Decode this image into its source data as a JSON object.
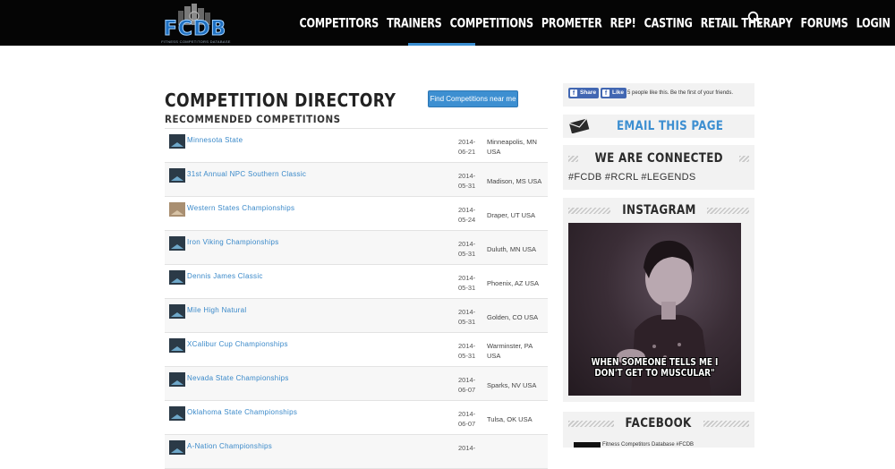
{
  "header": {
    "logo_text": "FCDB",
    "logo_subtitle": "FITNESS COMPETITORS DATABASE",
    "nav": [
      {
        "label": "COMPETITORS"
      },
      {
        "label": "TRAINERS"
      },
      {
        "label": "COMPETITIONS"
      },
      {
        "label": "PROMETER"
      },
      {
        "label": "REP!"
      },
      {
        "label": "CASTING"
      },
      {
        "label": "RETAIL THERAPY"
      },
      {
        "label": "FORUMS"
      },
      {
        "label": "LOGIN"
      }
    ],
    "search_icon": "search-icon",
    "active_color": "#3a8ed1"
  },
  "main": {
    "title": "COMPETITION DIRECTORY",
    "subtitle": "RECOMMENDED COMPETITIONS",
    "find_button": "Find Competitions near me",
    "competitions": [
      {
        "name": "Minnesota State",
        "date_y": "2014-",
        "date_md": "06-21",
        "location": "Minneapolis, MN USA"
      },
      {
        "name": "31st Annual NPC Southern Classic",
        "date_y": "2014-",
        "date_md": "05-31",
        "location": "Madison, MS USA"
      },
      {
        "name": "Western States Championships",
        "date_y": "2014-",
        "date_md": "05-24",
        "location": "Draper, UT USA"
      },
      {
        "name": "Iron Viking Championships",
        "date_y": "2014-",
        "date_md": "05-31",
        "location": "Duluth, MN USA"
      },
      {
        "name": "Dennis James Classic",
        "date_y": "2014-",
        "date_md": "05-31",
        "location": "Phoenix, AZ USA"
      },
      {
        "name": "Mile High Natural",
        "date_y": "2014-",
        "date_md": "05-31",
        "location": "Golden, CO USA"
      },
      {
        "name": "XCalibur Cup Championships",
        "date_y": "2014-",
        "date_md": "05-31",
        "location": "Warminster, PA USA"
      },
      {
        "name": "Nevada State Championships",
        "date_y": "2014-",
        "date_md": "06-07",
        "location": "Sparks, NV USA"
      },
      {
        "name": "Oklahoma State Championships",
        "date_y": "2014-",
        "date_md": "06-07",
        "location": "Tulsa, OK USA"
      },
      {
        "name": "A-Nation Championships",
        "date_y": "2014-",
        "date_md": "",
        "location": ""
      }
    ]
  },
  "sidebar": {
    "share_label": "Share",
    "like_label": "Like",
    "likes_text": "5 people like this. Be the first of your friends.",
    "email_title": "EMAIL THIS PAGE",
    "connected_title": "WE ARE CONNECTED",
    "hashtags": "#FCDB #RCRL #LEGENDS",
    "instagram_title": "INSTAGRAM",
    "instagram_caption": "WHEN SOMEONE TELLS ME I DON'T GET TO MUSCULAR\"",
    "facebook_title": "FACEBOOK",
    "facebook_strip": "Fitness Competitors Database #FCDB"
  }
}
